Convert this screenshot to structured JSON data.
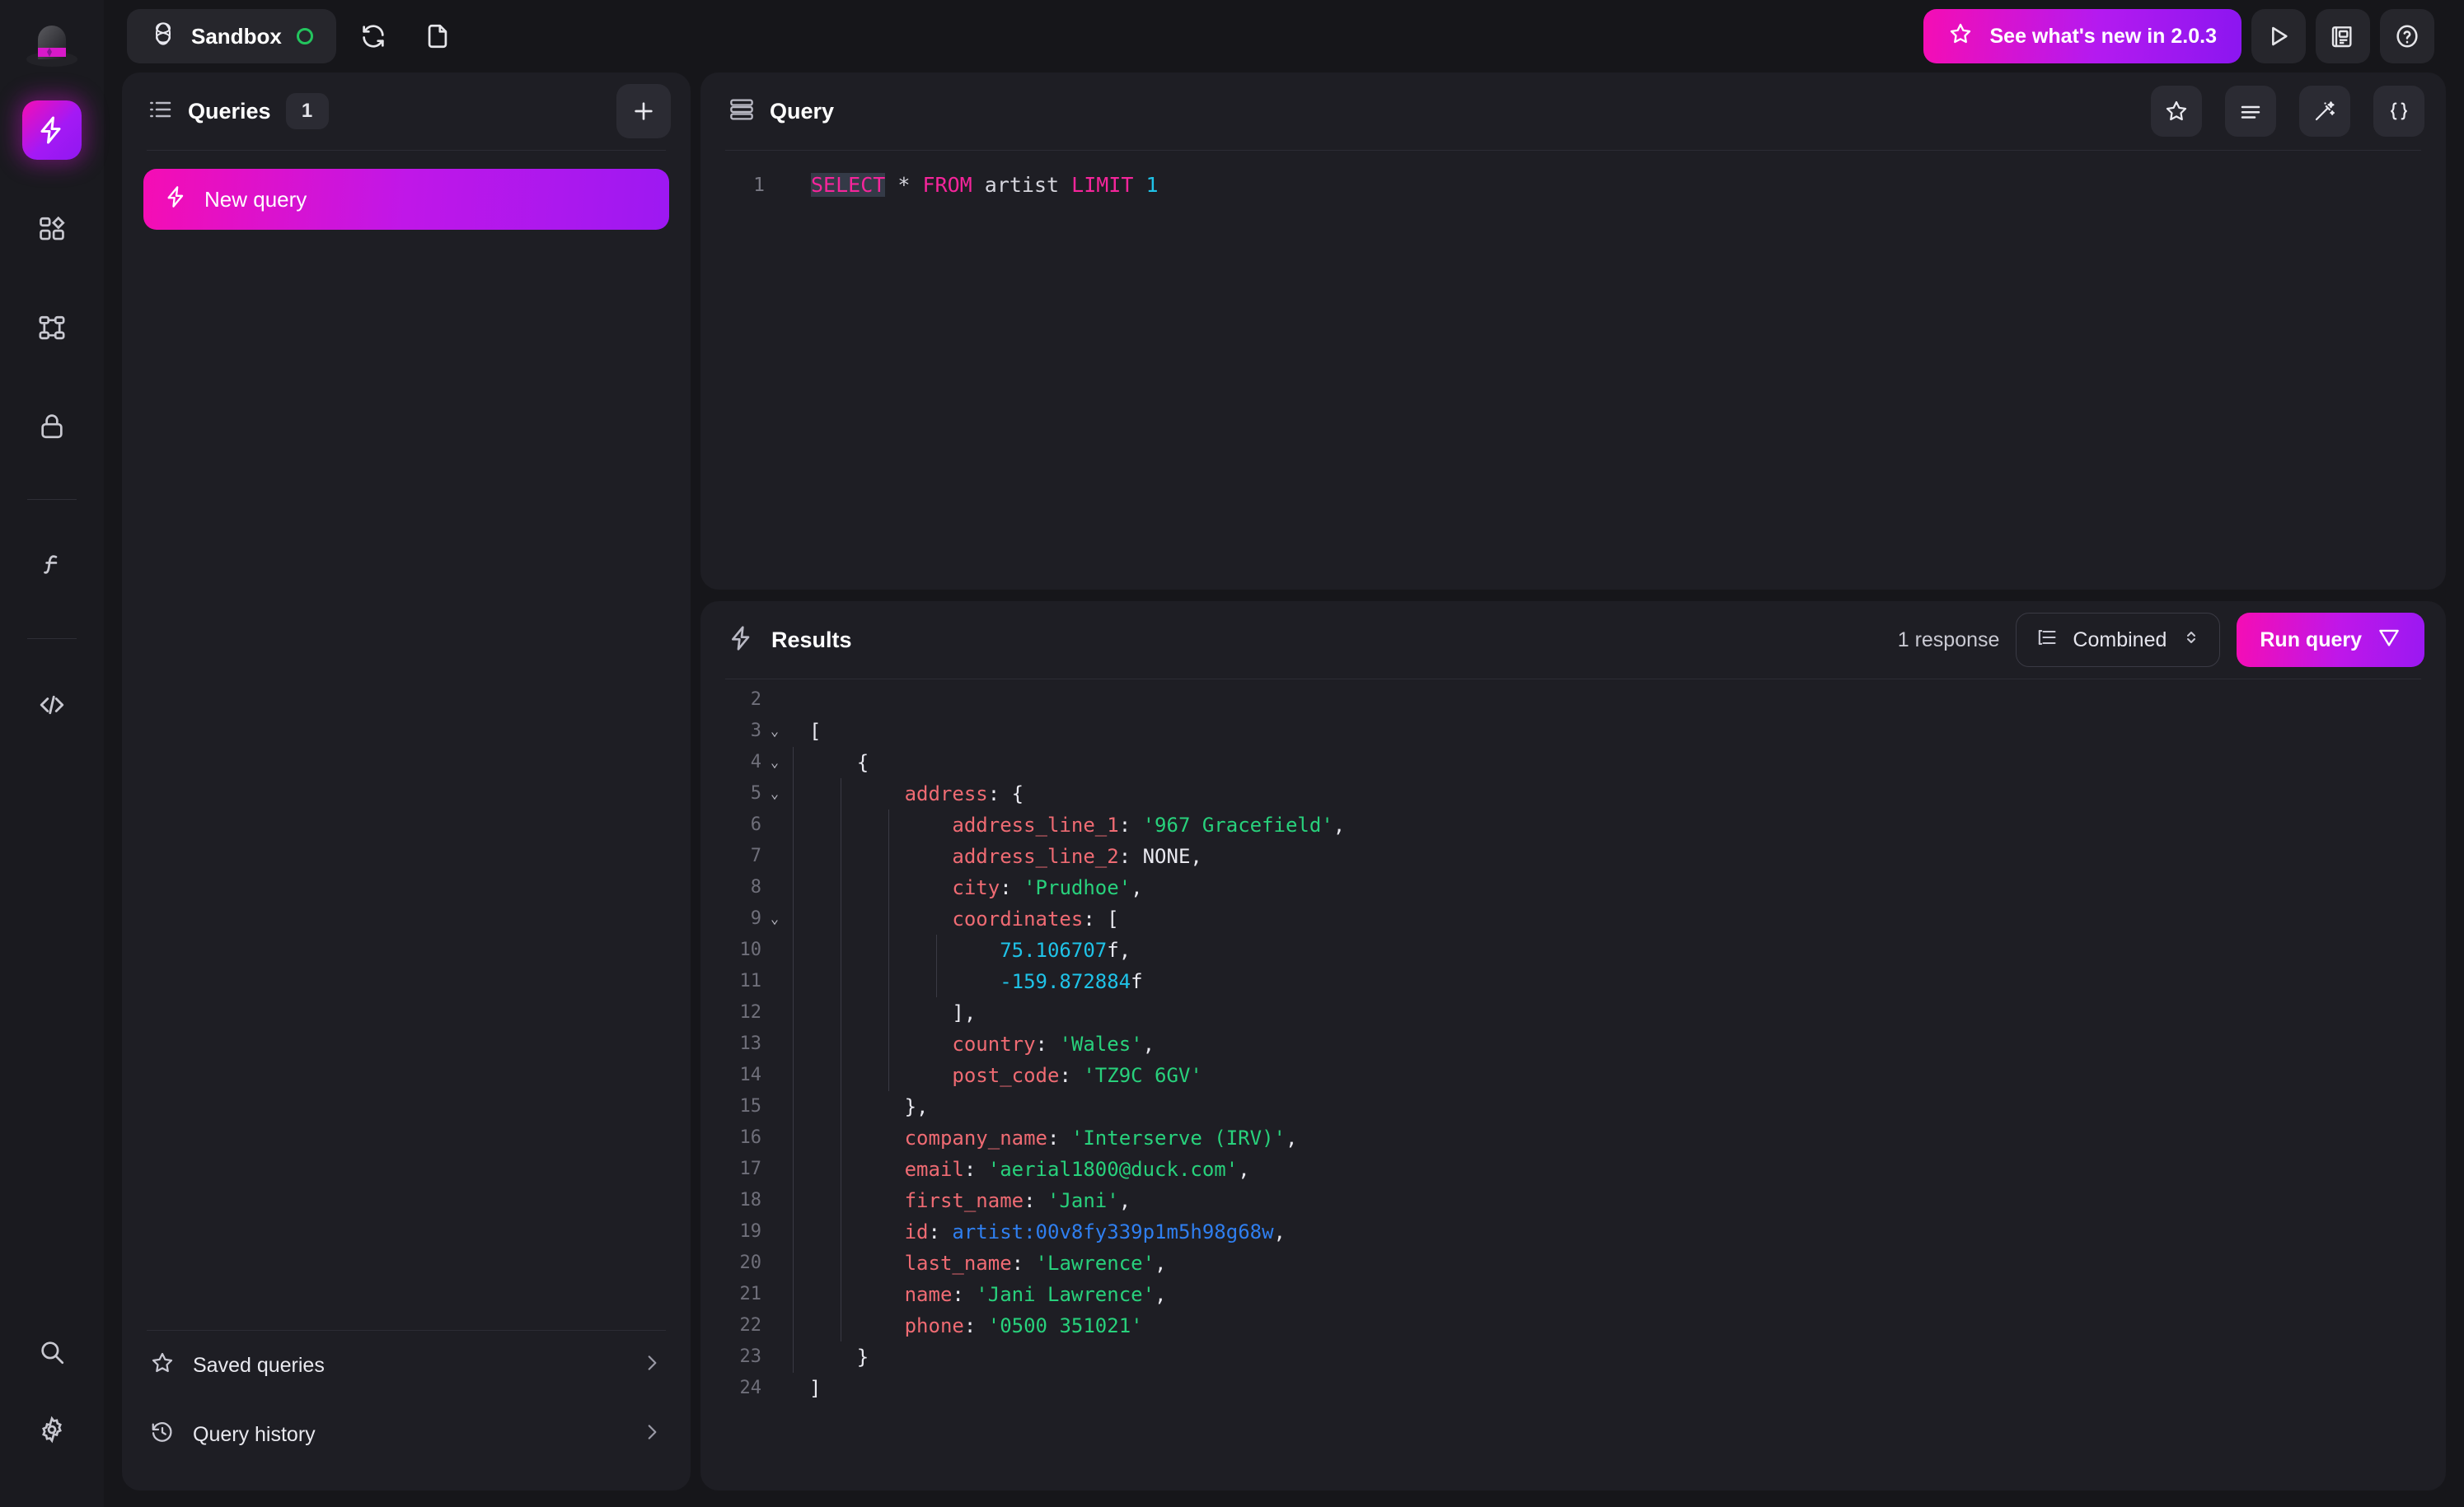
{
  "app": {
    "namespace": "Sandbox",
    "status_dot_color": "#23c55e",
    "accent_pink": "#f50db4",
    "accent_purple": "#9018f0"
  },
  "topbar": {
    "whats_new_label": "See what's new in 2.0.3",
    "icons": {
      "logo": "hat-logo",
      "namespace": "surreal-logo-icon",
      "reconnect": "reconnect-icon",
      "new_file": "file-icon",
      "star": "star-icon",
      "play": "play-icon",
      "news": "news-icon",
      "help": "help-icon"
    }
  },
  "rail": {
    "items": [
      {
        "name": "query",
        "icon": "lightning-icon",
        "active": true
      },
      {
        "name": "explorer",
        "icon": "blocks-icon",
        "active": false
      },
      {
        "name": "graphql",
        "icon": "nodes-icon",
        "active": false
      },
      {
        "name": "authentication",
        "icon": "lock-icon",
        "active": false
      },
      {
        "name": "functions",
        "icon": "function-icon",
        "active": false
      },
      {
        "name": "api-docs",
        "icon": "code-icon",
        "active": false
      }
    ],
    "bottom": [
      {
        "name": "search",
        "icon": "search-icon"
      },
      {
        "name": "settings",
        "icon": "gear-icon"
      }
    ]
  },
  "queries": {
    "title": "Queries",
    "count": "1",
    "new_tab_label": "+",
    "items": [
      {
        "label": "New query",
        "icon": "lightning-icon",
        "active": true
      }
    ],
    "footer": [
      {
        "label": "Saved queries",
        "icon": "star-icon"
      },
      {
        "label": "Query history",
        "icon": "history-icon"
      }
    ]
  },
  "query_panel": {
    "title": "Query",
    "icons": [
      "star-icon",
      "format-icon",
      "magic-wand-icon",
      "braces-icon"
    ],
    "editor": {
      "lines": [
        {
          "num": "1",
          "tokens": [
            {
              "t": "SELECT",
              "c": "kw sel"
            },
            {
              "t": " ",
              "c": "plain"
            },
            {
              "t": "*",
              "c": "plain"
            },
            {
              "t": " ",
              "c": "plain"
            },
            {
              "t": "FROM",
              "c": "kw"
            },
            {
              "t": " artist ",
              "c": "plain"
            },
            {
              "t": "LIMIT",
              "c": "kw"
            },
            {
              "t": " ",
              "c": "plain"
            },
            {
              "t": "1",
              "c": "num"
            }
          ]
        }
      ]
    }
  },
  "results": {
    "title": "Results",
    "response_count": "1 response",
    "mode": "Combined",
    "run_label": "Run query",
    "lines": [
      {
        "num": "2",
        "fold": "",
        "guides": [],
        "tokens": []
      },
      {
        "num": "3",
        "fold": "⌄",
        "guides": [],
        "tokens": [
          {
            "t": "[",
            "c": "p"
          }
        ]
      },
      {
        "num": "4",
        "fold": "⌄",
        "guides": [
          0
        ],
        "tokens": [
          {
            "t": "    {",
            "c": "p"
          }
        ]
      },
      {
        "num": "5",
        "fold": "⌄",
        "guides": [
          0,
          1
        ],
        "tokens": [
          {
            "t": "        ",
            "c": "p"
          },
          {
            "t": "address",
            "c": "k"
          },
          {
            "t": ": {",
            "c": "p"
          }
        ]
      },
      {
        "num": "6",
        "fold": "",
        "guides": [
          0,
          1,
          2
        ],
        "tokens": [
          {
            "t": "            ",
            "c": "p"
          },
          {
            "t": "address_line_1",
            "c": "k"
          },
          {
            "t": ": ",
            "c": "p"
          },
          {
            "t": "'967 Gracefield'",
            "c": "s"
          },
          {
            "t": ",",
            "c": "p"
          }
        ]
      },
      {
        "num": "7",
        "fold": "",
        "guides": [
          0,
          1,
          2
        ],
        "tokens": [
          {
            "t": "            ",
            "c": "p"
          },
          {
            "t": "address_line_2",
            "c": "k"
          },
          {
            "t": ": ",
            "c": "p"
          },
          {
            "t": "NONE",
            "c": "p"
          },
          {
            "t": ",",
            "c": "p"
          }
        ]
      },
      {
        "num": "8",
        "fold": "",
        "guides": [
          0,
          1,
          2
        ],
        "tokens": [
          {
            "t": "            ",
            "c": "p"
          },
          {
            "t": "city",
            "c": "k"
          },
          {
            "t": ": ",
            "c": "p"
          },
          {
            "t": "'Prudhoe'",
            "c": "s"
          },
          {
            "t": ",",
            "c": "p"
          }
        ]
      },
      {
        "num": "9",
        "fold": "⌄",
        "guides": [
          0,
          1,
          2
        ],
        "tokens": [
          {
            "t": "            ",
            "c": "p"
          },
          {
            "t": "coordinates",
            "c": "k"
          },
          {
            "t": ": [",
            "c": "p"
          }
        ]
      },
      {
        "num": "10",
        "fold": "",
        "guides": [
          0,
          1,
          2,
          3
        ],
        "tokens": [
          {
            "t": "                ",
            "c": "p"
          },
          {
            "t": "75.106707",
            "c": "n"
          },
          {
            "t": "f",
            "c": "p"
          },
          {
            "t": ",",
            "c": "p"
          }
        ]
      },
      {
        "num": "11",
        "fold": "",
        "guides": [
          0,
          1,
          2,
          3
        ],
        "tokens": [
          {
            "t": "                ",
            "c": "p"
          },
          {
            "t": "-159.872884",
            "c": "n"
          },
          {
            "t": "f",
            "c": "p"
          }
        ]
      },
      {
        "num": "12",
        "fold": "",
        "guides": [
          0,
          1,
          2
        ],
        "tokens": [
          {
            "t": "            ],",
            "c": "p"
          }
        ]
      },
      {
        "num": "13",
        "fold": "",
        "guides": [
          0,
          1,
          2
        ],
        "tokens": [
          {
            "t": "            ",
            "c": "p"
          },
          {
            "t": "country",
            "c": "k"
          },
          {
            "t": ": ",
            "c": "p"
          },
          {
            "t": "'Wales'",
            "c": "s"
          },
          {
            "t": ",",
            "c": "p"
          }
        ]
      },
      {
        "num": "14",
        "fold": "",
        "guides": [
          0,
          1,
          2
        ],
        "tokens": [
          {
            "t": "            ",
            "c": "p"
          },
          {
            "t": "post_code",
            "c": "k"
          },
          {
            "t": ": ",
            "c": "p"
          },
          {
            "t": "'TZ9C 6GV'",
            "c": "s"
          }
        ]
      },
      {
        "num": "15",
        "fold": "",
        "guides": [
          0,
          1
        ],
        "tokens": [
          {
            "t": "        },",
            "c": "p"
          }
        ]
      },
      {
        "num": "16",
        "fold": "",
        "guides": [
          0,
          1
        ],
        "tokens": [
          {
            "t": "        ",
            "c": "p"
          },
          {
            "t": "company_name",
            "c": "k"
          },
          {
            "t": ": ",
            "c": "p"
          },
          {
            "t": "'Interserve (IRV)'",
            "c": "s"
          },
          {
            "t": ",",
            "c": "p"
          }
        ]
      },
      {
        "num": "17",
        "fold": "",
        "guides": [
          0,
          1
        ],
        "tokens": [
          {
            "t": "        ",
            "c": "p"
          },
          {
            "t": "email",
            "c": "k"
          },
          {
            "t": ": ",
            "c": "p"
          },
          {
            "t": "'aerial1800@duck.com'",
            "c": "s"
          },
          {
            "t": ",",
            "c": "p"
          }
        ]
      },
      {
        "num": "18",
        "fold": "",
        "guides": [
          0,
          1
        ],
        "tokens": [
          {
            "t": "        ",
            "c": "p"
          },
          {
            "t": "first_name",
            "c": "k"
          },
          {
            "t": ": ",
            "c": "p"
          },
          {
            "t": "'Jani'",
            "c": "s"
          },
          {
            "t": ",",
            "c": "p"
          }
        ]
      },
      {
        "num": "19",
        "fold": "",
        "guides": [
          0,
          1
        ],
        "tokens": [
          {
            "t": "        ",
            "c": "p"
          },
          {
            "t": "id",
            "c": "k"
          },
          {
            "t": ": ",
            "c": "p"
          },
          {
            "t": "artist:00v8fy339p1m5h98g68w",
            "c": "rid"
          },
          {
            "t": ",",
            "c": "p"
          }
        ]
      },
      {
        "num": "20",
        "fold": "",
        "guides": [
          0,
          1
        ],
        "tokens": [
          {
            "t": "        ",
            "c": "p"
          },
          {
            "t": "last_name",
            "c": "k"
          },
          {
            "t": ": ",
            "c": "p"
          },
          {
            "t": "'Lawrence'",
            "c": "s"
          },
          {
            "t": ",",
            "c": "p"
          }
        ]
      },
      {
        "num": "21",
        "fold": "",
        "guides": [
          0,
          1
        ],
        "tokens": [
          {
            "t": "        ",
            "c": "p"
          },
          {
            "t": "name",
            "c": "k"
          },
          {
            "t": ": ",
            "c": "p"
          },
          {
            "t": "'Jani Lawrence'",
            "c": "s"
          },
          {
            "t": ",",
            "c": "p"
          }
        ]
      },
      {
        "num": "22",
        "fold": "",
        "guides": [
          0,
          1
        ],
        "tokens": [
          {
            "t": "        ",
            "c": "p"
          },
          {
            "t": "phone",
            "c": "k"
          },
          {
            "t": ": ",
            "c": "p"
          },
          {
            "t": "'0500 351021'",
            "c": "s"
          }
        ]
      },
      {
        "num": "23",
        "fold": "",
        "guides": [
          0
        ],
        "tokens": [
          {
            "t": "    }",
            "c": "p"
          }
        ]
      },
      {
        "num": "24",
        "fold": "",
        "guides": [],
        "tokens": [
          {
            "t": "]",
            "c": "p"
          }
        ]
      }
    ]
  }
}
